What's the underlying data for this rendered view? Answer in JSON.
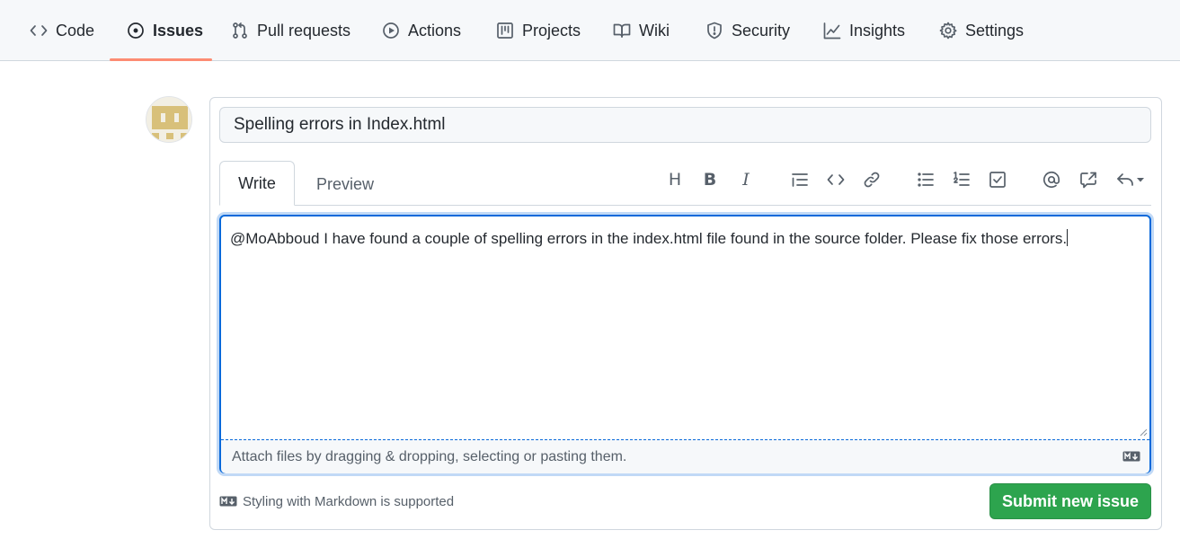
{
  "nav": {
    "tabs": [
      {
        "label": "Code",
        "icon": "code-icon"
      },
      {
        "label": "Issues",
        "icon": "issue-opened-icon",
        "active": true
      },
      {
        "label": "Pull requests",
        "icon": "git-pull-request-icon"
      },
      {
        "label": "Actions",
        "icon": "play-icon"
      },
      {
        "label": "Projects",
        "icon": "project-icon"
      },
      {
        "label": "Wiki",
        "icon": "book-icon"
      },
      {
        "label": "Security",
        "icon": "shield-icon"
      },
      {
        "label": "Insights",
        "icon": "graph-icon"
      },
      {
        "label": "Settings",
        "icon": "gear-icon"
      }
    ],
    "active_color": "#fd8c73"
  },
  "issue": {
    "title": "Spelling errors in Index.html",
    "body": "@MoAbboud I have found a couple of spelling errors in the index.html file found in the source folder. Please fix those errors."
  },
  "editor": {
    "tabs": {
      "write": "Write",
      "preview": "Preview"
    },
    "toolbar": [
      "heading-icon",
      "bold-icon",
      "italic-icon",
      "quote-icon",
      "code-icon",
      "link-icon",
      "unordered-list-icon",
      "ordered-list-icon",
      "task-list-icon",
      "mention-icon",
      "cross-reference-icon",
      "reply-icon"
    ],
    "toolbar_glyphs": {
      "heading": "H",
      "bold": "B",
      "italic": "I"
    },
    "attach_text": "Attach files by dragging & dropping, selecting or pasting them.",
    "focus_color": "#0969da"
  },
  "footer": {
    "markdown_note": "Styling with Markdown is supported",
    "submit_label": "Submit new issue",
    "submit_color": "#2da44e"
  }
}
